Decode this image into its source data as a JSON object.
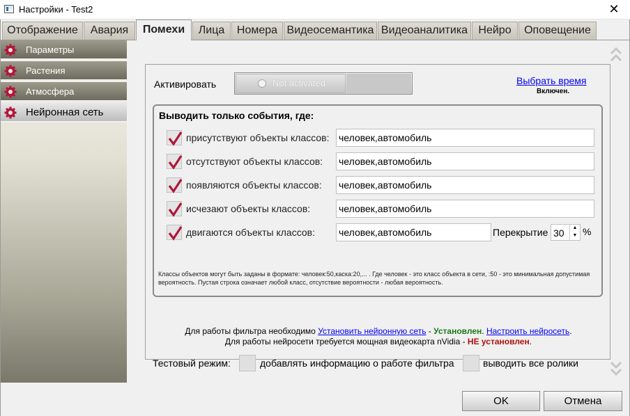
{
  "window": {
    "title": "Настройки - Test2"
  },
  "tabs": [
    {
      "label": "Отображение"
    },
    {
      "label": "Авария"
    },
    {
      "label": "Помехи"
    },
    {
      "label": "Лица"
    },
    {
      "label": "Номера"
    },
    {
      "label": "Видеосемантика"
    },
    {
      "label": "Видеоаналитика"
    },
    {
      "label": "Нейро"
    },
    {
      "label": "Оповещение"
    }
  ],
  "active_tab": "Помехи",
  "sidebar": {
    "items": [
      {
        "label": "Параметры",
        "icon": "gear-icon"
      },
      {
        "label": "Растения",
        "icon": "gear-icon"
      },
      {
        "label": "Атмосфера",
        "icon": "gear-icon"
      },
      {
        "label": "Нейронная сеть",
        "icon": "gear-icon"
      }
    ],
    "active_item": "Нейронная сеть"
  },
  "activation": {
    "label": "Активировать",
    "toggle_text": "Not activated",
    "schedule_link": "Выбрать время",
    "schedule_status": "Включен."
  },
  "filter": {
    "title": "Выводить только события, где:",
    "rows": [
      {
        "label": "присутствуют объекты классов:",
        "value": "человек,автомобиль",
        "checked": true
      },
      {
        "label": "отсутствуют объекты классов:",
        "value": "человек,автомобиль",
        "checked": true
      },
      {
        "label": "появляются объекты классов:",
        "value": "человек,автомобиль",
        "checked": true
      },
      {
        "label": "исчезают объекты классов:",
        "value": "человек,автомобиль",
        "checked": true
      },
      {
        "label": "двигаются объекты классов:",
        "value": "человек,автомобиль",
        "checked": true
      }
    ],
    "overlap": {
      "label": "Перекрытие",
      "value": "30",
      "unit": "%"
    },
    "hint": "Классы объектов могут быть заданы в формате: человек:50,каска:20,... . Где человек - это класс объекта в сети, :50 - это минимальная допустимая вероятность. Пустая строка означает любой класс, отсутствие вероятности - любая вероятность."
  },
  "info": {
    "line1_prefix": "Для работы фильтра необходимо ",
    "install_link": "Установить нейронную сеть",
    "line1_dash": " - ",
    "installed": "Установлен",
    "line1_sep": ". ",
    "configure_link": "Настроить нейросеть",
    "line1_end": ".",
    "line2_prefix": "Для работы нейросети требуется мощная видеокарта nVidia - ",
    "not_installed": "НЕ установлен",
    "line2_end": "."
  },
  "test_mode": {
    "label": "Тестовый режим:",
    "option1": "добавлять информацию о работе фильтра",
    "option2": "выводить все ролики"
  },
  "buttons": {
    "ok": "OK",
    "cancel": "Отмена"
  },
  "colors": {
    "accent_red": "#b0173a",
    "link": "#0000ee",
    "installed_green": "#1a7a1a",
    "not_installed_red": "#b01010"
  }
}
